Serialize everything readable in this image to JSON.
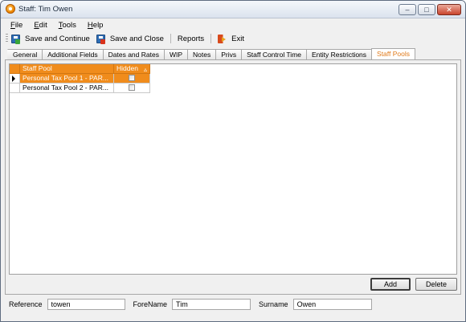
{
  "window": {
    "title": "Staff: Tim Owen"
  },
  "menu": [
    {
      "label": "File",
      "ul": "F",
      "rest": "ile"
    },
    {
      "label": "Edit",
      "ul": "E",
      "rest": "dit"
    },
    {
      "label": "Tools",
      "ul": "T",
      "rest": "ools"
    },
    {
      "label": "Help",
      "ul": "H",
      "rest": "elp"
    }
  ],
  "toolbar": {
    "save_continue": "Save and Continue",
    "save_close": "Save and Close",
    "reports": "Reports",
    "exit": "Exit"
  },
  "tabs": [
    "General",
    "Additional Fields",
    "Dates and Rates",
    "WIP",
    "Notes",
    "Privs",
    "Staff Control Time",
    "Entity Restrictions",
    "Staff Pools"
  ],
  "active_tab": "Staff Pools",
  "grid": {
    "columns": {
      "pool": "Staff Pool",
      "hidden": "Hidden"
    },
    "rows": [
      {
        "pool": "Personal Tax Pool 1 - PAR...",
        "hidden": false,
        "selected": true
      },
      {
        "pool": "Personal Tax Pool 2 - PAR...",
        "hidden": false,
        "selected": false
      }
    ]
  },
  "buttons": {
    "add": "Add",
    "delete": "Delete"
  },
  "fields": {
    "reference_label": "Reference",
    "reference_value": "towen",
    "forename_label": "ForeName",
    "forename_value": "Tim",
    "surname_label": "Surname",
    "surname_value": "Owen"
  },
  "colors": {
    "accent": "#f08c1c"
  }
}
